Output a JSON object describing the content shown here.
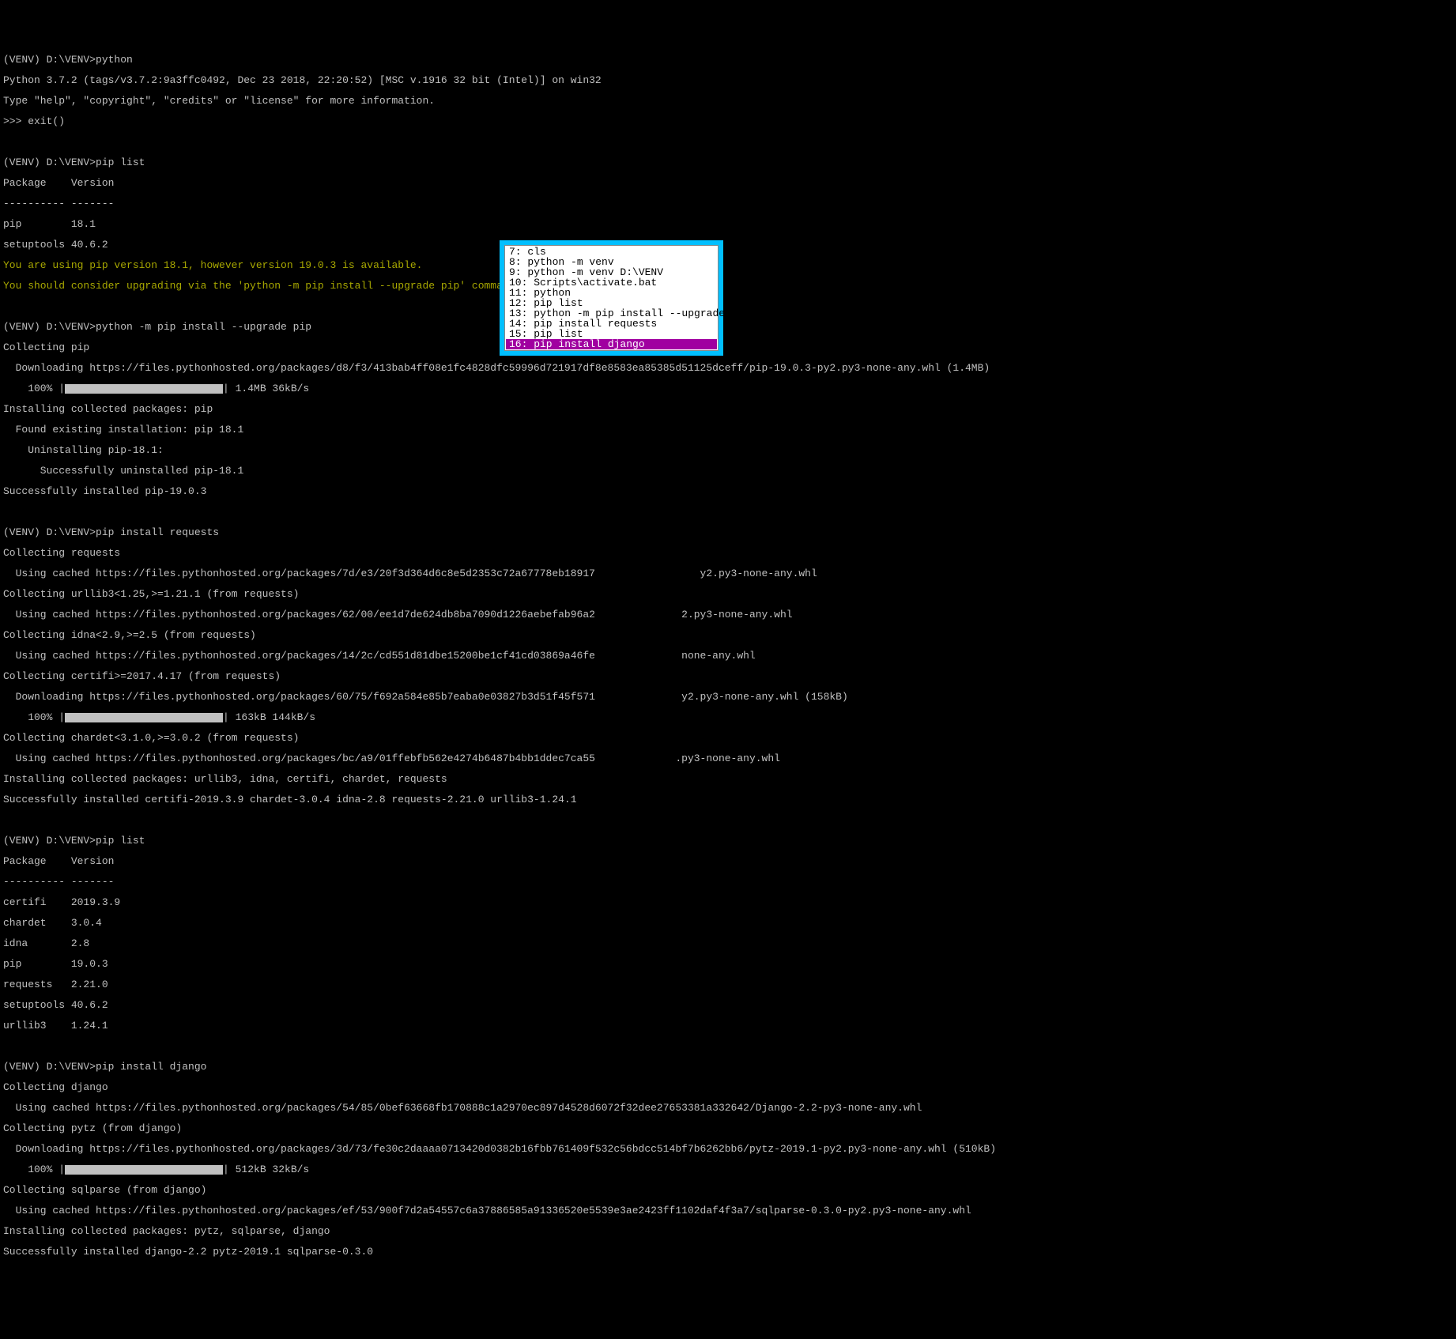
{
  "terminal": {
    "block1": {
      "prompt": "(VENV) D:\\VENV>python",
      "line2": "Python 3.7.2 (tags/v3.7.2:9a3ffc0492, Dec 23 2018, 22:20:52) [MSC v.1916 32 bit (Intel)] on win32",
      "line3": "Type \"help\", \"copyright\", \"credits\" or \"license\" for more information.",
      "line4": ">>> exit()"
    },
    "block2": {
      "prompt": "(VENV) D:\\VENV>pip list",
      "header": "Package    Version",
      "divider": "---------- -------",
      "row1": "pip        18.1",
      "row2": "setuptools 40.6.2",
      "warn1": "You are using pip version 18.1, however version 19.0.3 is available.",
      "warn2": "You should consider upgrading via the 'python -m pip install --upgrade pip' command."
    },
    "block3": {
      "prompt": "(VENV) D:\\VENV>python -m pip install --upgrade pip",
      "l1": "Collecting pip",
      "l2": "  Downloading https://files.pythonhosted.org/packages/d8/f3/413bab4ff08e1fc4828dfc59996d721917df8e8583ea85385d51125dceff/pip-19.0.3-py2.py3-none-any.whl (1.4MB)",
      "bar_label_pre": "    100% |",
      "bar_label_post": "| 1.4MB 36kB/s",
      "l4": "Installing collected packages: pip",
      "l5": "  Found existing installation: pip 18.1",
      "l6": "    Uninstalling pip-18.1:",
      "l7": "      Successfully uninstalled pip-18.1",
      "l8": "Successfully installed pip-19.0.3"
    },
    "block4": {
      "prompt": "(VENV) D:\\VENV>pip install requests",
      "l1": "Collecting requests",
      "l2": "  Using cached https://files.pythonhosted.org/packages/7d/e3/20f3d364d6c8e5d2353c72a67778eb18917                 y2.py3-none-any.whl",
      "l3": "Collecting urllib3<1.25,>=1.21.1 (from requests)",
      "l4": "  Using cached https://files.pythonhosted.org/packages/62/00/ee1d7de624db8ba7090d1226aebefab96a2              2.py3-none-any.whl",
      "l5": "Collecting idna<2.9,>=2.5 (from requests)",
      "l6": "  Using cached https://files.pythonhosted.org/packages/14/2c/cd551d81dbe15200be1cf41cd03869a46fe              none-any.whl",
      "l7": "Collecting certifi>=2017.4.17 (from requests)",
      "l8": "  Downloading https://files.pythonhosted.org/packages/60/75/f692a584e85b7eaba0e03827b3d51f45f571              y2.py3-none-any.whl (158kB)",
      "bar_label_pre": "    100% |",
      "bar_label_post": "| 163kB 144kB/s",
      "l10": "Collecting chardet<3.1.0,>=3.0.2 (from requests)",
      "l11": "  Using cached https://files.pythonhosted.org/packages/bc/a9/01ffebfb562e4274b6487b4bb1ddec7ca55             .py3-none-any.whl",
      "l12": "Installing collected packages: urllib3, idna, certifi, chardet, requests",
      "l13": "Successfully installed certifi-2019.3.9 chardet-3.0.4 idna-2.8 requests-2.21.0 urllib3-1.24.1"
    },
    "block5": {
      "prompt": "(VENV) D:\\VENV>pip list",
      "header": "Package    Version",
      "divider": "---------- -------",
      "r1": "certifi    2019.3.9",
      "r2": "chardet    3.0.4",
      "r3": "idna       2.8",
      "r4": "pip        19.0.3",
      "r5": "requests   2.21.0",
      "r6": "setuptools 40.6.2",
      "r7": "urllib3    1.24.1"
    },
    "block6": {
      "prompt": "(VENV) D:\\VENV>pip install django",
      "l1": "Collecting django",
      "l2": "  Using cached https://files.pythonhosted.org/packages/54/85/0bef63668fb170888c1a2970ec897d4528d6072f32dee27653381a332642/Django-2.2-py3-none-any.whl",
      "l3": "Collecting pytz (from django)",
      "l4": "  Downloading https://files.pythonhosted.org/packages/3d/73/fe30c2daaaa0713420d0382b16fbb761409f532c56bdcc514bf7b6262bb6/pytz-2019.1-py2.py3-none-any.whl (510kB)",
      "bar_label_pre": "    100% |",
      "bar_label_post": "| 512kB 32kB/s",
      "l6": "Collecting sqlparse (from django)",
      "l7": "  Using cached https://files.pythonhosted.org/packages/ef/53/900f7d2a54557c6a37886585a91336520e5539e3ae2423ff1102daf4f3a7/sqlparse-0.3.0-py2.py3-none-any.whl",
      "l8": "Installing collected packages: pytz, sqlparse, django",
      "l9": "Successfully installed django-2.2 pytz-2019.1 sqlparse-0.3.0"
    }
  },
  "history": {
    "items": [
      {
        "num": "7",
        "cmd": "cls"
      },
      {
        "num": "8",
        "cmd": "python -m venv"
      },
      {
        "num": "9",
        "cmd": "python -m venv D:\\VENV"
      },
      {
        "num": "10",
        "cmd": "Scripts\\activate.bat"
      },
      {
        "num": "11",
        "cmd": "python"
      },
      {
        "num": "12",
        "cmd": "pip list"
      },
      {
        "num": "13",
        "cmd": "python -m pip install --upgrade pip"
      },
      {
        "num": "14",
        "cmd": "pip install requests"
      },
      {
        "num": "15",
        "cmd": "pip list"
      },
      {
        "num": "16",
        "cmd": "pip install django"
      }
    ],
    "selected_index": 9
  }
}
